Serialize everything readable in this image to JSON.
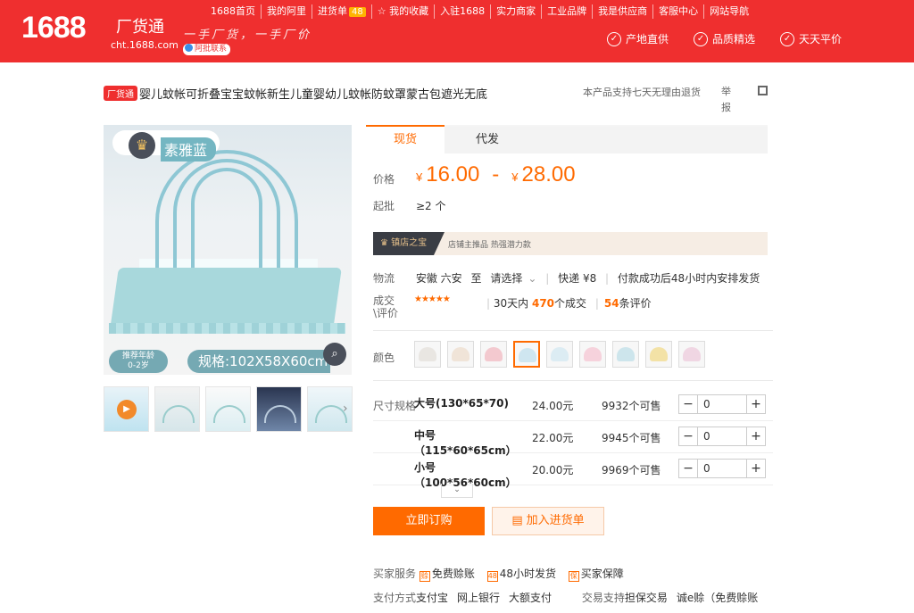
{
  "header": {
    "logo_number": "1688",
    "logo_name": "厂货通",
    "logo_url": "cht.1688.com",
    "slogan": "一手厂货，一手厂价",
    "slogan_badge": "阿批联系",
    "nav": [
      "1688首页",
      "我的阿里",
      "进货单",
      "我的收藏",
      "入驻1688",
      "实力商家",
      "工业品牌",
      "我是供应商",
      "客服中心",
      "网站导航"
    ],
    "cart_count": "48",
    "promises": [
      "产地直供",
      "品质精选",
      "天天平价"
    ]
  },
  "product": {
    "tag": "厂货通",
    "title": "婴儿蚊帐可折叠宝宝蚊帐新生儿童婴幼儿蚊帐防蚊罩蒙古包遮光无底",
    "return_policy": "本产品支持七天无理由退货",
    "report": "举报",
    "image_color_label": "素雅蓝",
    "image_age_label": "推荐年龄",
    "image_age_value": "0-2岁",
    "image_spec": "规格:102X58X60cm"
  },
  "tabs": [
    "现货",
    "代发"
  ],
  "price": {
    "label": "价格",
    "currency": "¥",
    "min": "16.00",
    "max": "28.00",
    "min_order_label": "起批",
    "min_order": "≥2 个"
  },
  "store": {
    "badge": "镇店之宝",
    "text": "店铺主推品  热强潜力款"
  },
  "logistics": {
    "label": "物流",
    "from": "安徽 六安",
    "to_label": "至",
    "to": "请选择",
    "express": "快递 ¥8",
    "ship": "付款成功后48小时内安排发货"
  },
  "deals": {
    "label": "成交\\评价",
    "stars": "★★★★★",
    "period": "30天内",
    "count": "470",
    "count_suffix": "个成交",
    "reviews": "54",
    "reviews_suffix": "条评价"
  },
  "colors": {
    "label": "颜色",
    "swatches": [
      "#e9e6e2",
      "#f0e4d8",
      "#f3c9cf",
      "#cfe6f0",
      "#dcecf3",
      "#f6d2dc",
      "#cde5ec",
      "#f3e2a6",
      "#f0d6e3"
    ],
    "selected_index": 3
  },
  "sizes": {
    "label": "尺寸规格",
    "rows": [
      {
        "name": "大号(130*65*70)",
        "price": "24.00元",
        "stock": "9932个可售",
        "qty": "0"
      },
      {
        "name": "中号（115*60*65cm）",
        "price": "22.00元",
        "stock": "9945个可售",
        "qty": "0"
      },
      {
        "name": "小号（100*56*60cm）",
        "price": "20.00元",
        "stock": "9969个可售",
        "qty": "0"
      }
    ]
  },
  "actions": {
    "buy": "立即订购",
    "cart": "加入进货单"
  },
  "services": {
    "buyer_label": "买家服务",
    "buyer_items": [
      "免费赊账",
      "48小时发货",
      "买家保障"
    ],
    "pay_label": "支付方式",
    "pay_items": [
      "支付宝",
      "网上银行",
      "大额支付"
    ],
    "trade_label": "交易支持",
    "trade_items": [
      "担保交易",
      "诚e赊（免费赊账"
    ]
  }
}
